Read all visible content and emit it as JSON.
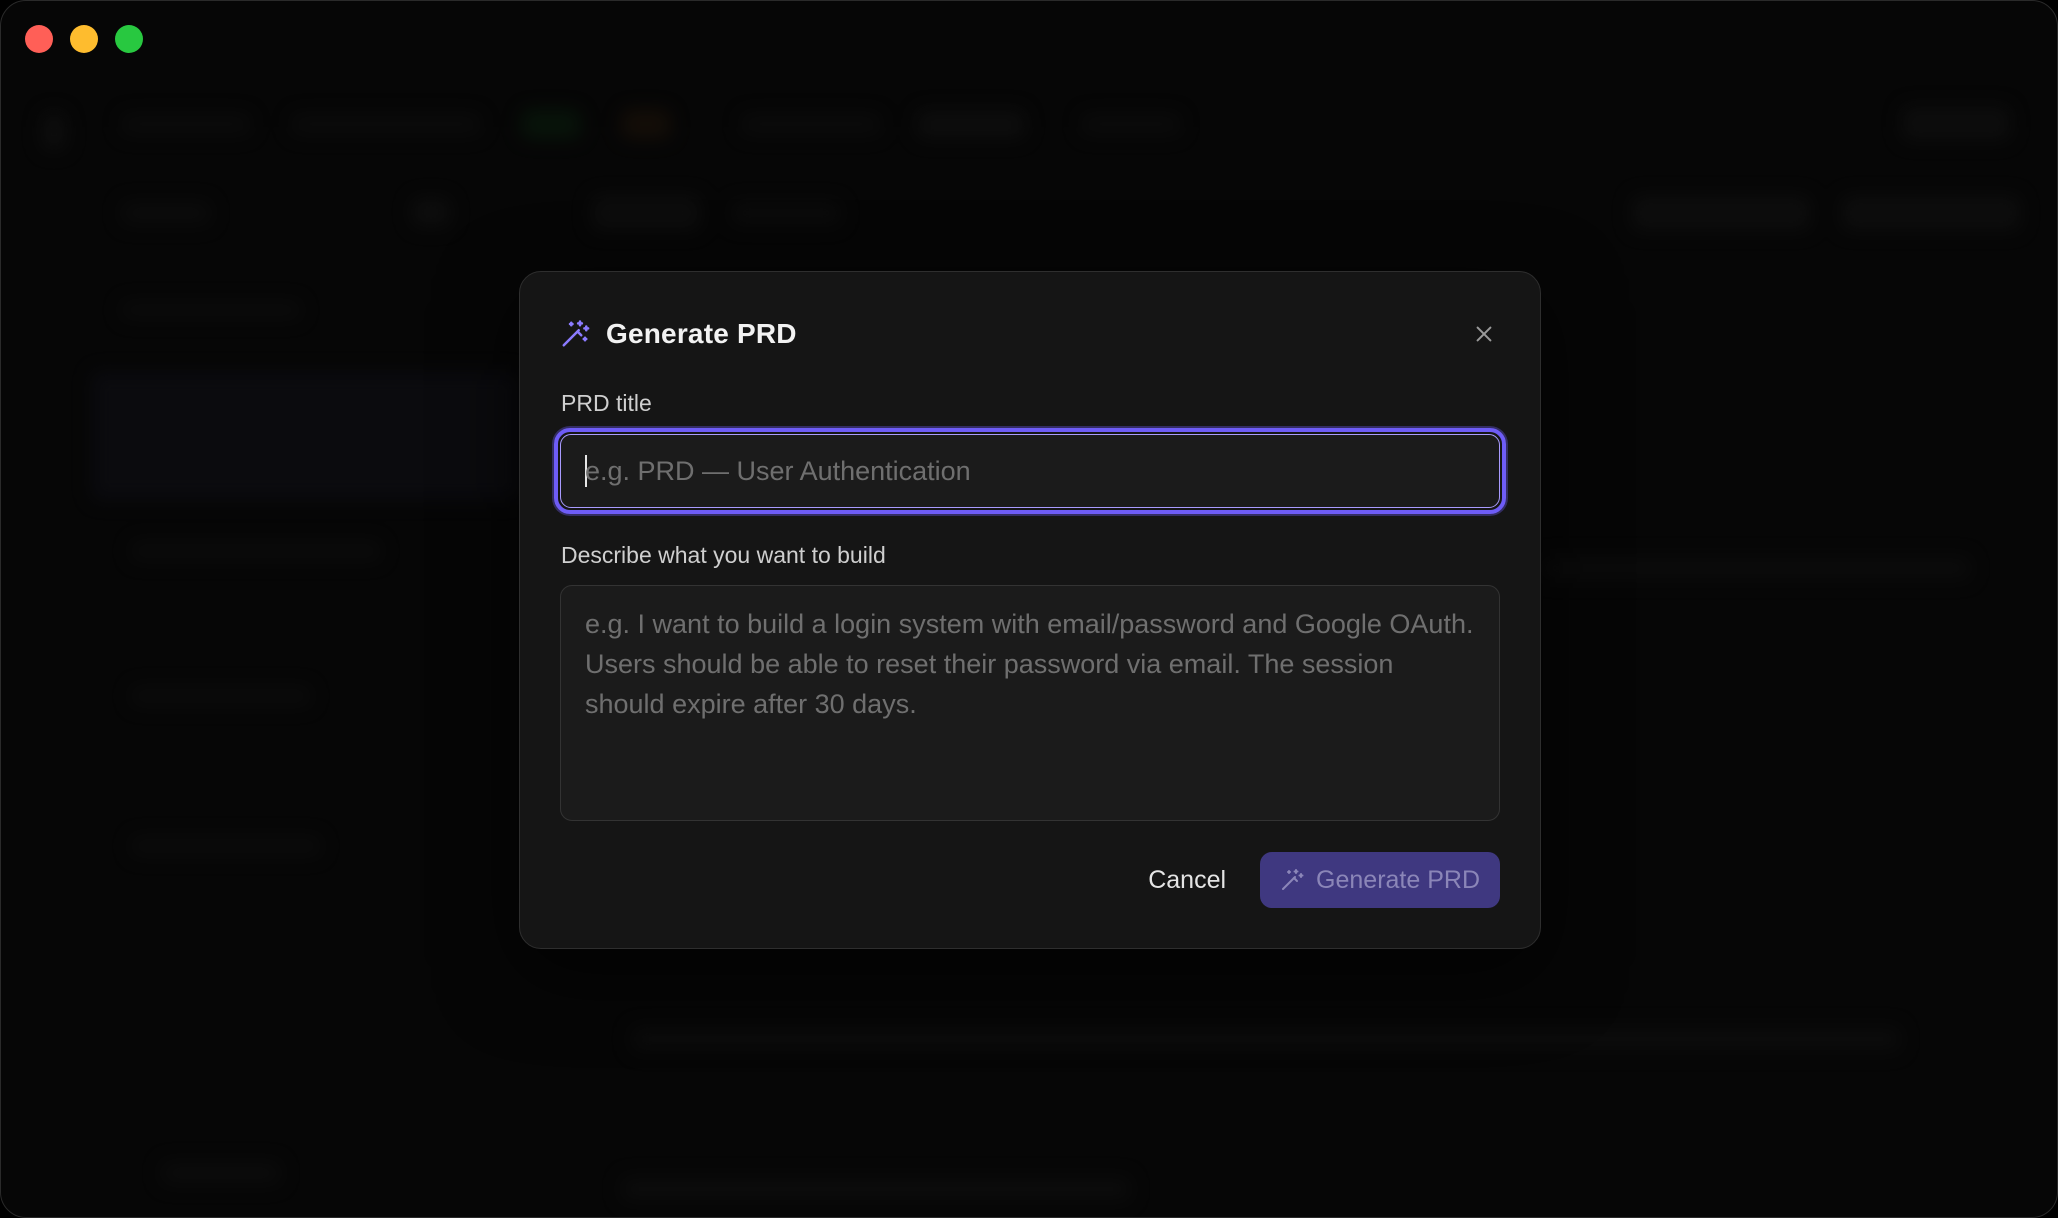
{
  "window": {
    "traffic_lights": [
      "close",
      "minimize",
      "maximize"
    ]
  },
  "modal": {
    "title": "Generate PRD",
    "title_icon": "magic-wand-icon",
    "close_icon": "close-icon",
    "title_field": {
      "label": "PRD title",
      "value": "",
      "placeholder": "e.g. PRD — User Authentication"
    },
    "description_field": {
      "label": "Describe what you want to build",
      "value": "",
      "placeholder": "e.g. I want to build a login system with email/password and Google OAuth. Users should be able to reset their password via email. The session should expire after 30 days."
    },
    "cancel_label": "Cancel",
    "generate_label": "Generate PRD"
  },
  "colors": {
    "accent": "#6e5cf6",
    "generate_button_bg": "#3f3880",
    "modal_bg": "#151515"
  }
}
